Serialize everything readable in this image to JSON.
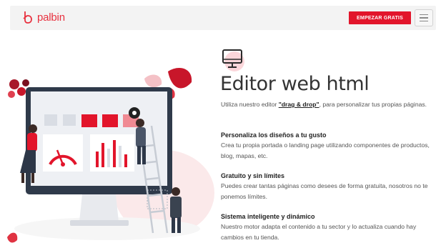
{
  "header": {
    "logo_text": "palbin",
    "cta_label": "EMPEZAR GRATIS",
    "menu_icon": "hamburger-icon"
  },
  "hero": {
    "icon": "monitor-icon",
    "title": "Editor web html",
    "intro_before": "Utiliza nuestro editor ",
    "intro_highlight": "\"drag & drop\"",
    "intro_after": ", para personalizar tus propias páginas."
  },
  "features": [
    {
      "heading": "Personaliza los diseños a tu gusto",
      "text": "Crea tu propia portada o landing page utilizando componentes de productos, blog, mapas, etc."
    },
    {
      "heading": "Gratuito y sin límites",
      "text": "Puedes crear tantas páginas como desees de forma gratuita, nosotros no te ponemos límites."
    },
    {
      "heading": "Sistema inteligente y dinámico",
      "text": "Nuestro motor adapta el contenido a tu sector y lo actualiza cuando hay cambios en tu tienda."
    }
  ],
  "colors": {
    "brand": "#e2152b",
    "brand_light": "#f5c6cb",
    "text": "#333333"
  }
}
